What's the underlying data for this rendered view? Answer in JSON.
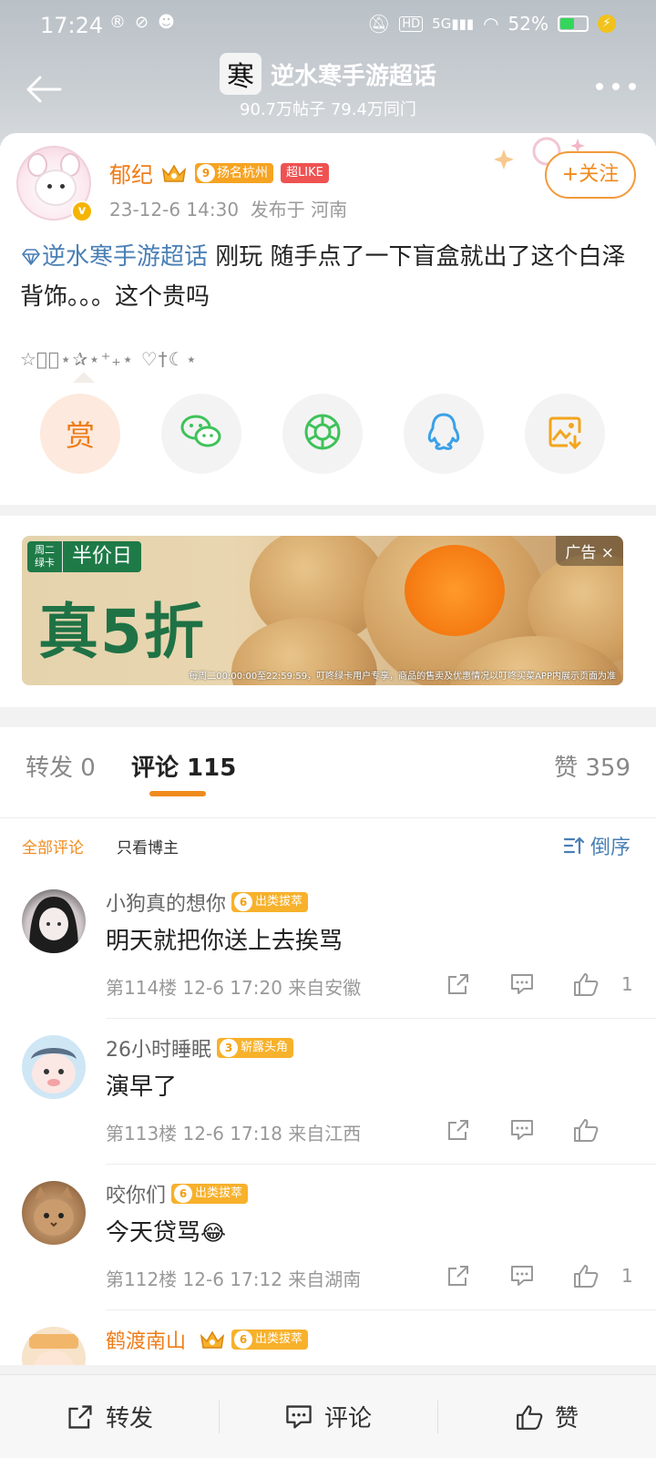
{
  "status_bar": {
    "time": "17:24",
    "network": "5G",
    "hd": "HD",
    "battery": "52%",
    "battery_level": 0.52,
    "left_icons": [
      "location-icon",
      "link-icon",
      "game-icon"
    ]
  },
  "nav": {
    "title": "逆水寒手游超话",
    "logo_char": "寒",
    "subtitle": "90.7万帖子 79.4万同门"
  },
  "post": {
    "author": "郁纪",
    "badge_level": "9",
    "badge_text": "扬名杭州",
    "super_badge": "超LIKE",
    "time": "23-12-6 14:30",
    "location": "发布于 河南",
    "follow_label": "+关注",
    "topic": "逆水寒手游超话",
    "text": " 刚玩 随手点了一下盲盒就出了这个白泽背饰。。。这个贵吗",
    "deco_text": "☆ﾟ｡⋆✰⋆⁺₊⋆ ♡†☾⋆",
    "reward_label": "赏",
    "share_icons": [
      "wechat-icon",
      "moments-icon",
      "qq-icon",
      "save-image-icon"
    ]
  },
  "ad": {
    "tag_small": "周二绿卡",
    "tag_big": "半价日",
    "headline": "真5折",
    "label": "广告 ×",
    "footnote": "每周二00:00:00至22:59:59，叮咚绿卡用户专享，商品的售卖及优惠情况以叮咚买菜APP内展示页面为准"
  },
  "tabs": {
    "repost": "转发 0",
    "comment": "评论 115",
    "likes": "赞 359"
  },
  "filters": {
    "all": "全部评论",
    "author_only": "只看博主",
    "sort": "倒序"
  },
  "comments": [
    {
      "name": "小狗真的想你",
      "badge_level": "6",
      "badge_text": "出类拔萃",
      "text": "明天就把你送上去挨骂",
      "meta": "第114楼 12-6 17:20 来自安徽",
      "likes": "1"
    },
    {
      "name": "26小时睡眠",
      "badge_level": "3",
      "badge_text": "崭露头角",
      "text": "演早了",
      "meta": "第113楼 12-6 17:18 来自江西",
      "likes": ""
    },
    {
      "name": "咬你们",
      "badge_level": "6",
      "badge_text": "出类拔萃",
      "text": "今天贷骂",
      "emoji": "😂",
      "meta": "第112楼 12-6 17:12 来自湖南",
      "likes": "1"
    },
    {
      "name": "鹤渡南山",
      "badge_level": "6",
      "badge_text": "出类拔萃",
      "text": "",
      "meta": "",
      "likes": ""
    }
  ],
  "bottom_bar": {
    "repost": "转发",
    "comment": "评论",
    "like": "赞"
  },
  "colors": {
    "accent": "#f08a1c",
    "link": "#4a7fb5",
    "header_bg": "#c3c8cd"
  }
}
